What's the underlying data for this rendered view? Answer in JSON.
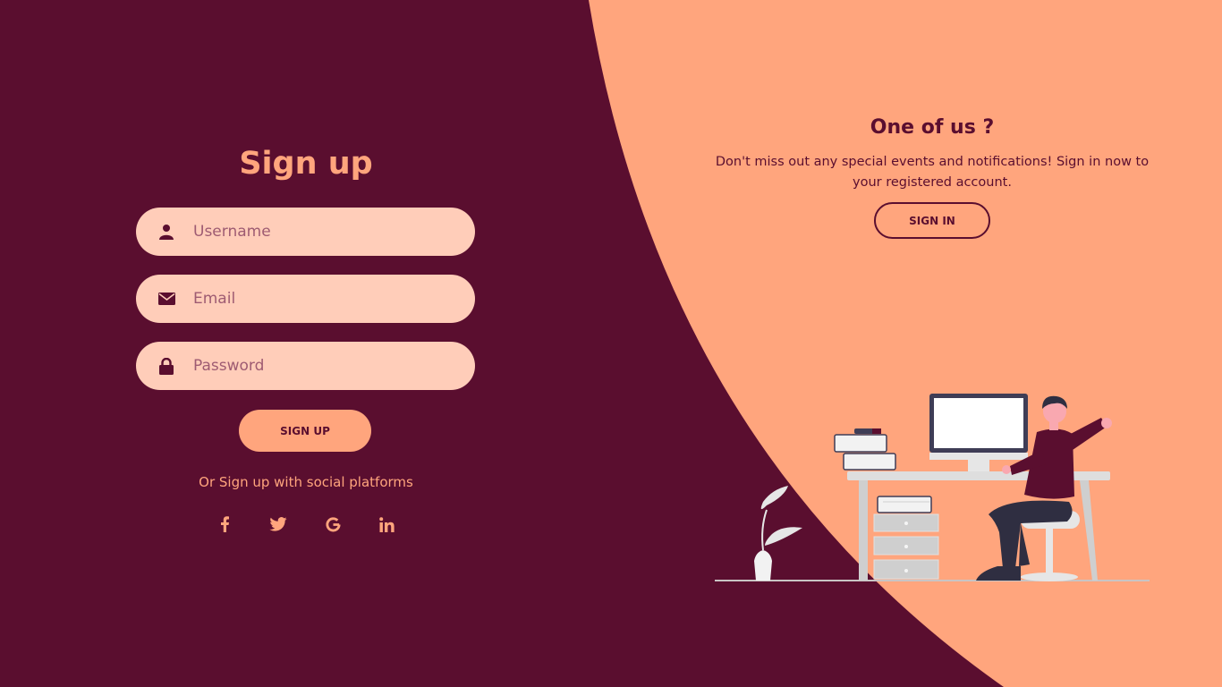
{
  "signup": {
    "title": "Sign up",
    "fields": [
      {
        "placeholder": "Username",
        "icon": "user-icon"
      },
      {
        "placeholder": "Email",
        "icon": "envelope-icon"
      },
      {
        "placeholder": "Password",
        "icon": "lock-icon"
      }
    ],
    "button_label": "SIGN UP",
    "social_text": "Or Sign up with social platforms",
    "social_icons": [
      "facebook-icon",
      "twitter-icon",
      "google-icon",
      "linkedin-icon"
    ]
  },
  "signin_panel": {
    "title": "One of us ?",
    "text": "Don't miss out any special events and notifications! Sign in now to your registered account.",
    "button_label": "SIGN IN"
  },
  "colors": {
    "dark": "#5a0e2f",
    "accent": "#ffa57d",
    "field_bg": "#ffcdb9"
  }
}
